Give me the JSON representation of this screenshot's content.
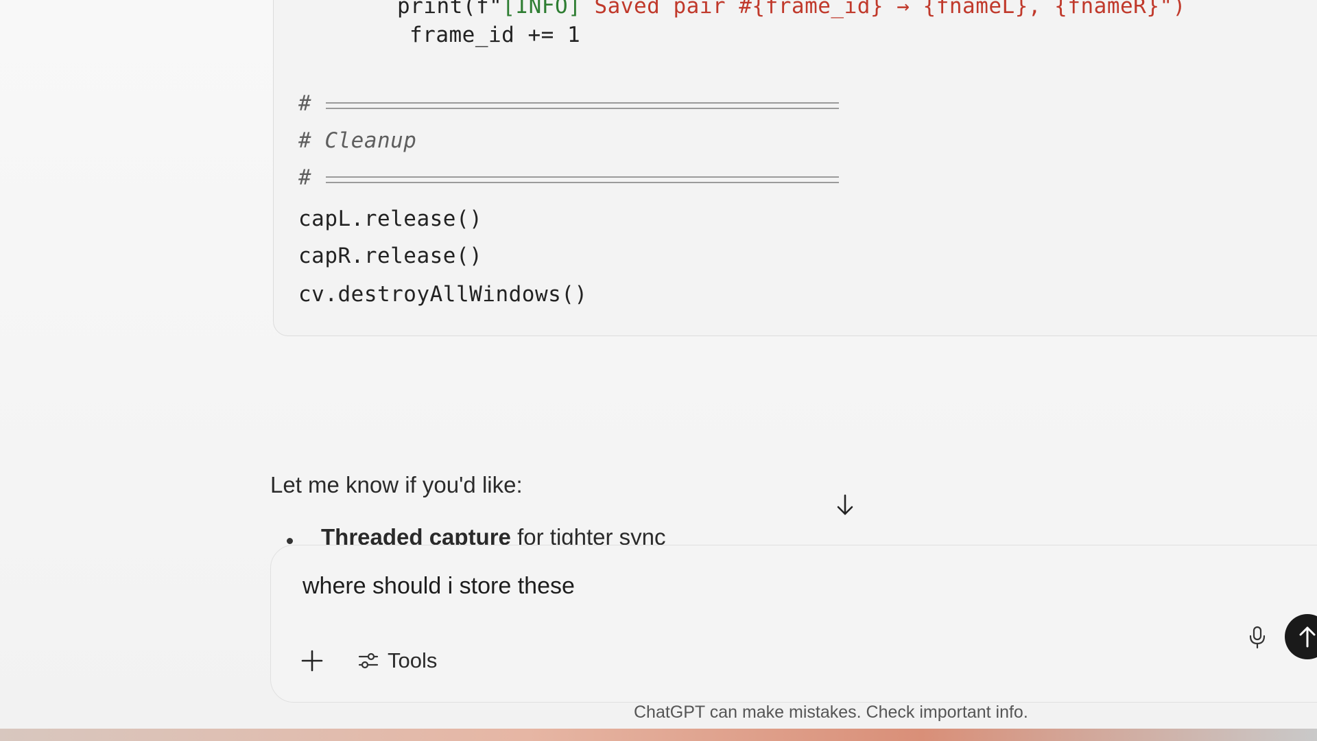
{
  "code_block": {
    "lines": {
      "print_prefix": "print(f\"",
      "info_tag": "[INFO]",
      "saved_msg": " Saved pair #{frame_id} → {fnameL}, {fnameR}\")",
      "frame_inc": "frame_id += 1",
      "rule1_hash": "#",
      "cleanup_comment": "# Cleanup",
      "rule2_hash": "#",
      "capL_release": "capL.release()",
      "capR_release": "capR.release()",
      "destroy_windows": "cv.destroyAllWindows()"
    }
  },
  "assistant": {
    "intro": "Let me know if you'd like:",
    "bullet_bold": "Threaded capture",
    "bullet_rest": " for tighter sync"
  },
  "composer": {
    "input_text": "where should i store these",
    "tools_label": "Tools"
  },
  "footer": {
    "disclaimer": "ChatGPT can make mistakes. Check important info."
  },
  "icons": {
    "scroll_down": "arrow-down-icon",
    "plus": "plus-icon",
    "tools": "sliders-icon",
    "mic": "microphone-icon",
    "send": "arrow-up-icon"
  }
}
